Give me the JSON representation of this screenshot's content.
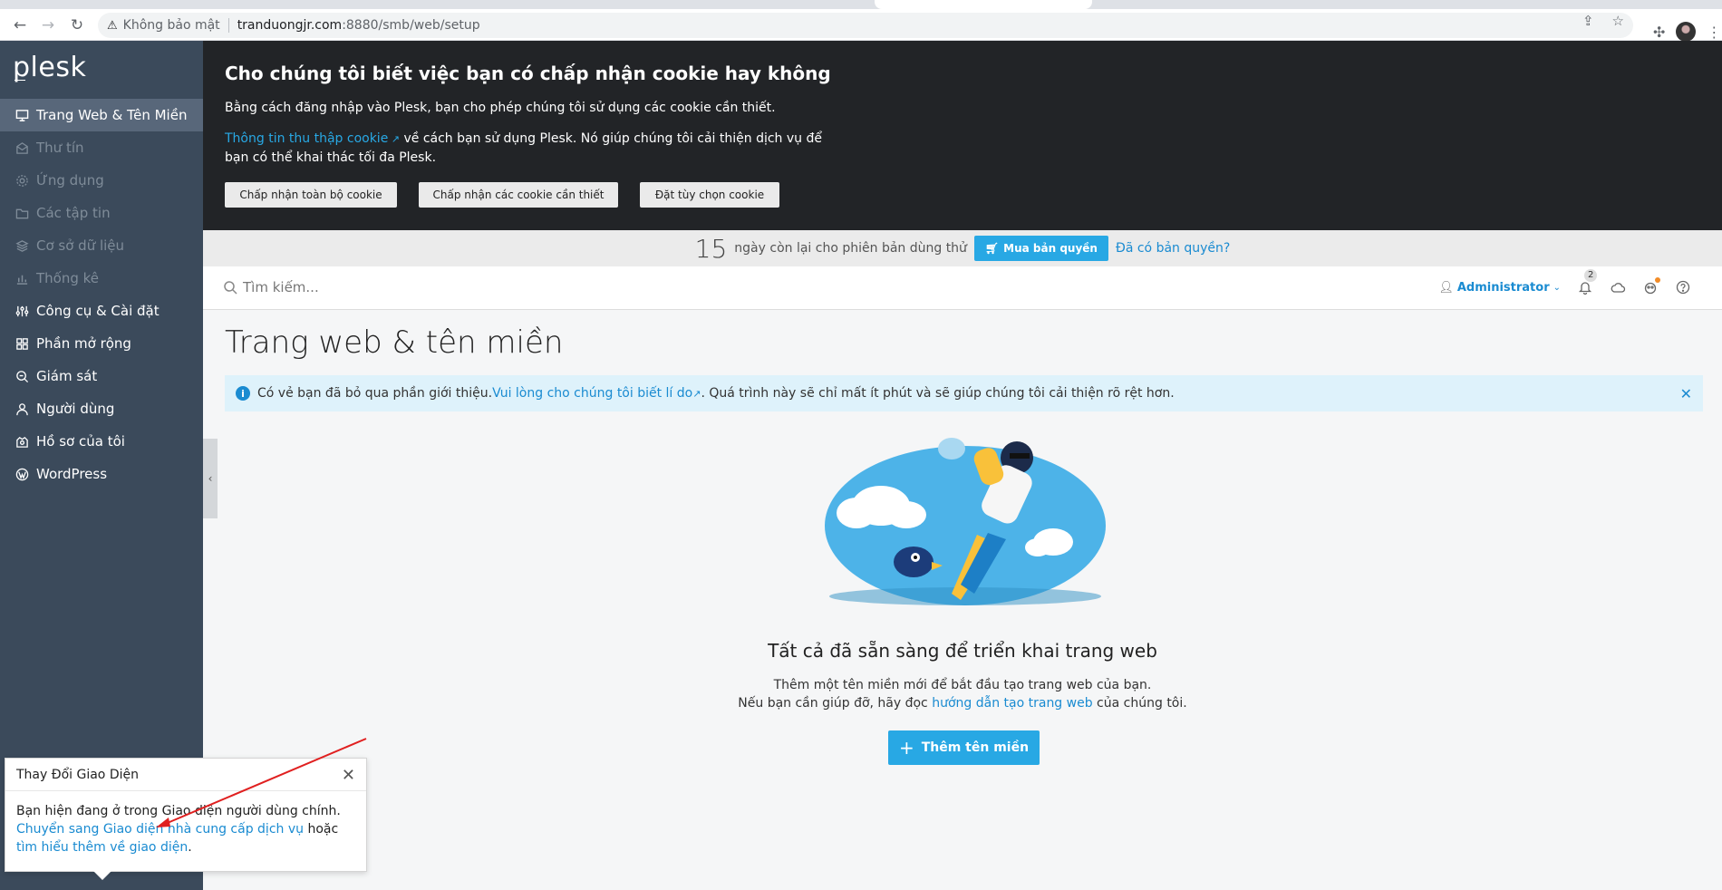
{
  "browser": {
    "security_label": "Không bảo mật",
    "url_host": "tranduongjr.com",
    "url_path": ":8880/smb/web/setup"
  },
  "sidebar": {
    "logo": "plesk",
    "items": [
      {
        "label": "Trang Web & Tên Miền",
        "icon": "monitor-icon",
        "state": "active"
      },
      {
        "label": "Thư tín",
        "icon": "mail-icon",
        "state": "disabled"
      },
      {
        "label": "Ứng dụng",
        "icon": "gear-icon",
        "state": "disabled"
      },
      {
        "label": "Các tập tin",
        "icon": "folder-icon",
        "state": "disabled"
      },
      {
        "label": "Cơ sở dữ liệu",
        "icon": "database-icon",
        "state": "disabled"
      },
      {
        "label": "Thống kê",
        "icon": "bar-chart-icon",
        "state": "disabled"
      },
      {
        "label": "Công cụ & Cài đặt",
        "icon": "sliders-icon",
        "state": "normal"
      },
      {
        "label": "Phần mở rộng",
        "icon": "extensions-icon",
        "state": "normal"
      },
      {
        "label": "Giám sát",
        "icon": "monitor-search-icon",
        "state": "normal"
      },
      {
        "label": "Người dùng",
        "icon": "user-icon",
        "state": "normal"
      },
      {
        "label": "Hồ sơ của tôi",
        "icon": "profile-icon",
        "state": "normal"
      },
      {
        "label": "WordPress",
        "icon": "wordpress-icon",
        "state": "normal"
      }
    ]
  },
  "cookie": {
    "title": "Cho chúng tôi biết việc bạn có chấp nhận cookie hay không",
    "text1": "Bằng cách đăng nhập vào Plesk, bạn cho phép chúng tôi sử dụng các cookie cần thiết.",
    "link": "Thông tin thu thập cookie",
    "text2": " về cách bạn sử dụng Plesk. Nó giúp chúng tôi cải thiện dịch vụ để bạn có thể khai thác tối đa Plesk.",
    "btn_accept_all": "Chấp nhận toàn bộ cookie",
    "btn_accept_required": "Chấp nhận các cookie cần thiết",
    "btn_customize": "Đặt tùy chọn cookie"
  },
  "trial": {
    "days": "15",
    "text": "ngày còn lại cho phiên bản dùng thử",
    "buy": "Mua bản quyền",
    "have": "Đã có bản quyền?"
  },
  "topbar": {
    "search_placeholder": "Tìm kiếm...",
    "user": "Administrator",
    "notifications": "2"
  },
  "main": {
    "title": "Trang web & tên miền",
    "info_text1": "Có vẻ bạn đã bỏ qua phần giới thiệu. ",
    "info_link": "Vui lòng cho chúng tôi biết lí do",
    "info_text2": ". Quá trình này sẽ chỉ mất ít phút và sẽ giúp chúng tôi cải thiện rõ rệt hơn.",
    "ready_title": "Tất cả đã sẵn sàng để triển khai trang web",
    "ready_line1": "Thêm một tên miền mới để bắt đầu tạo trang web của bạn.",
    "ready_line2a": "Nếu bạn cần giúp đỡ, hãy đọc ",
    "ready_link": "hướng dẫn tạo trang web",
    "ready_line2b": " của chúng tôi.",
    "add_button": "Thêm tên miền"
  },
  "popup": {
    "title": "Thay Đổi Giao Diện",
    "text1": "Bạn hiện đang ở trong Giao diện người dùng chính.",
    "link1": "Chuyển sang Giao diện nhà cung cấp dịch vụ",
    "text2": " hoặc ",
    "link2": "tìm hiểu thêm về giao diện",
    "text3": "."
  },
  "colors": {
    "sidebar_bg": "#3b4a5b",
    "accent": "#28a8e4",
    "annotation_arrow": "#e02020"
  }
}
